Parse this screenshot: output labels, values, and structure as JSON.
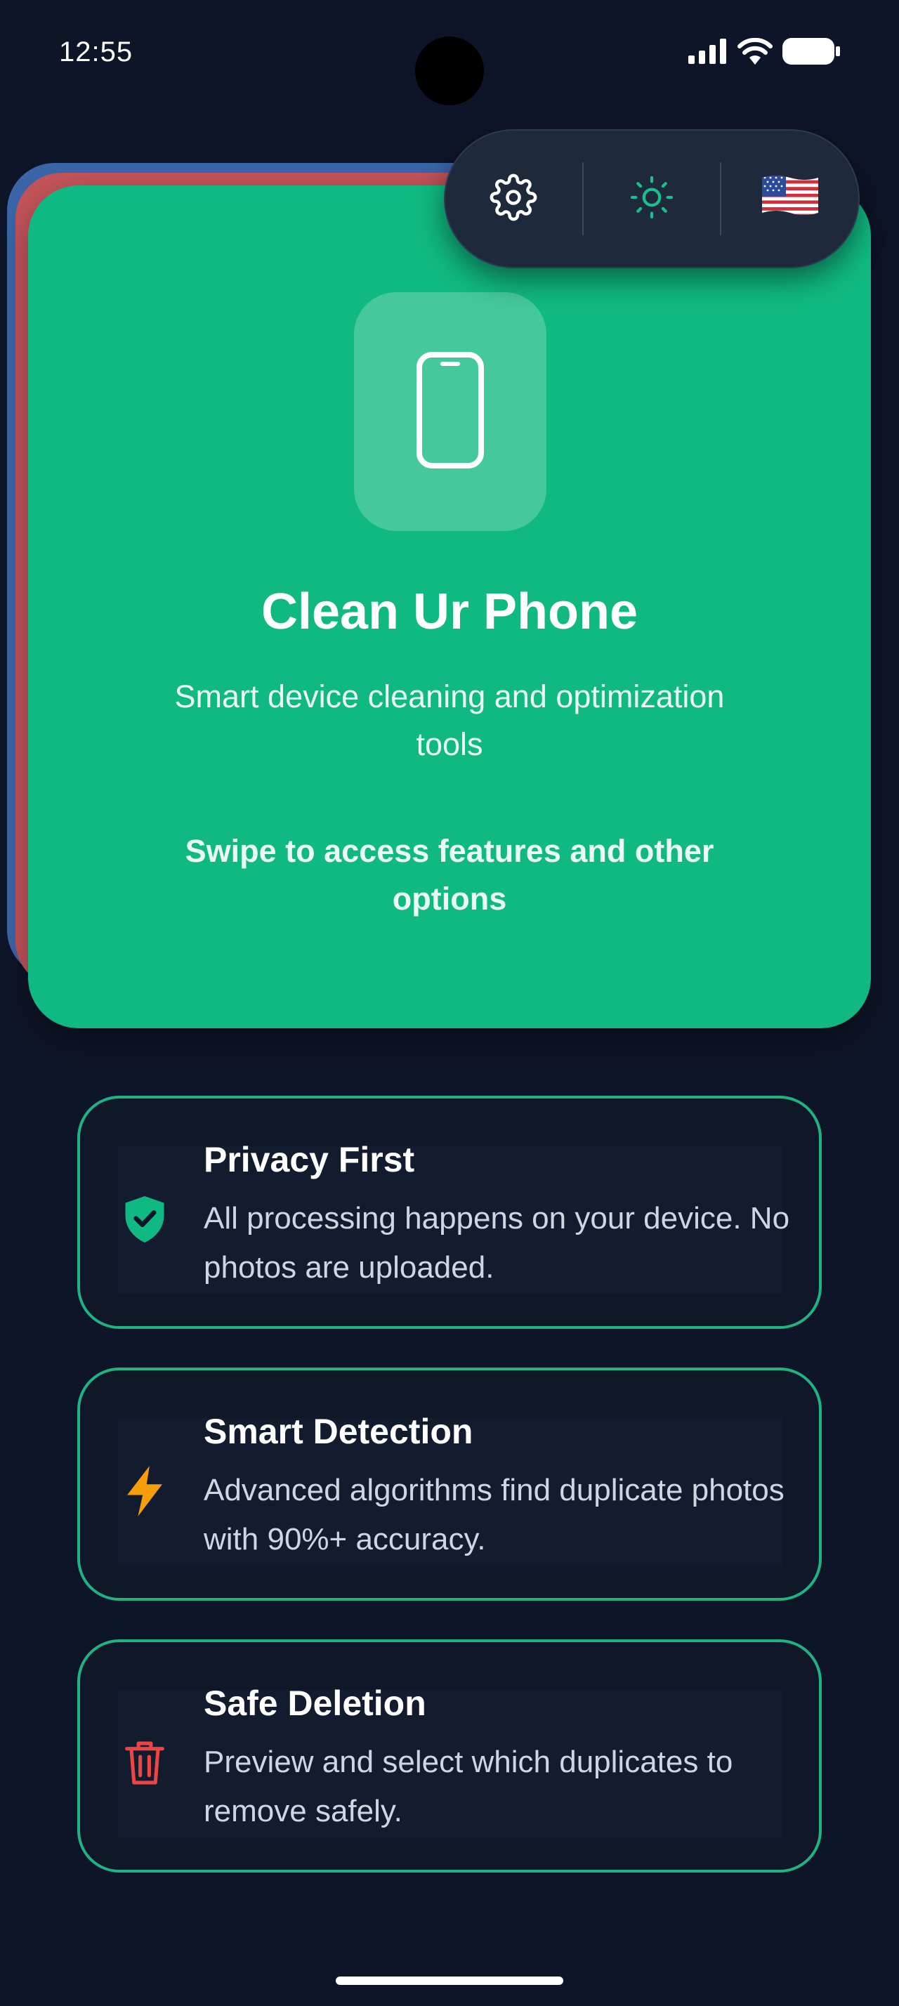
{
  "status_bar": {
    "time": "12:55"
  },
  "toolbar": {
    "settings_icon": "gear-icon",
    "theme_icon": "sun-icon",
    "language_flag": "🇺🇸"
  },
  "hero": {
    "icon": "smartphone-icon",
    "title": "Clean Ur Phone",
    "subtitle": "Smart device cleaning and optimization tools",
    "hint": "Swipe to access features and other options"
  },
  "features": [
    {
      "icon": "shield-check-icon",
      "title": "Privacy First",
      "description": "All processing happens on your device. No photos are uploaded."
    },
    {
      "icon": "lightning-icon",
      "title": "Smart Detection",
      "description": "Advanced algorithms find duplicate photos with 90%+ accuracy."
    },
    {
      "icon": "trash-icon",
      "title": "Safe Deletion",
      "description": "Preview and select which duplicates to remove safely."
    }
  ],
  "colors": {
    "background": "#0e1528",
    "hero_green": "#10b981",
    "card_border": "#20b382",
    "accent_orange": "#f59e0b",
    "accent_red": "#ef4444"
  }
}
